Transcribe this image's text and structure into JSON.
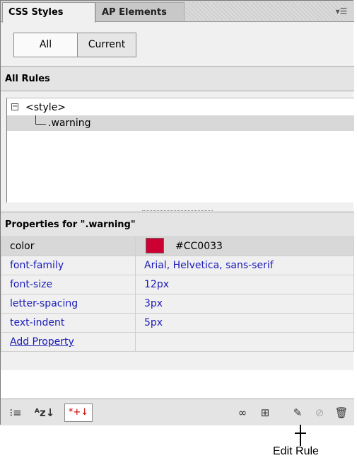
{
  "tabs": [
    {
      "label": "CSS Styles",
      "active": true
    },
    {
      "label": "AP Elements",
      "active": false
    }
  ],
  "panel_menu_icon": "panel-options-icon",
  "view_toggle": {
    "all_label": "All",
    "current_label": "Current",
    "selected": "All"
  },
  "all_rules": {
    "header": "All Rules",
    "tree": [
      {
        "label": "<style>",
        "expander": "⊟",
        "level": 0
      },
      {
        "label": ".warning",
        "level": 1,
        "selected": true
      }
    ]
  },
  "properties": {
    "header": "Properties for \".warning\"",
    "rows": [
      {
        "name": "color",
        "value": "#CC0033",
        "swatch": "#CC0033",
        "selected": true
      },
      {
        "name": "font-family",
        "value": "Arial, Helvetica, sans-serif"
      },
      {
        "name": "font-size",
        "value": "12px"
      },
      {
        "name": "letter-spacing",
        "value": "3px"
      },
      {
        "name": "text-indent",
        "value": "5px"
      }
    ],
    "add_property_label": "Add Property"
  },
  "toolbar": {
    "left_icons": [
      "category-view-icon",
      "list-view-icon",
      "set-properties-only-icon"
    ],
    "right_icons": [
      "attach-style-sheet-icon",
      "new-css-rule-icon",
      "edit-rule-icon",
      "disable-property-icon",
      "delete-rule-icon"
    ]
  },
  "callout": {
    "label": "Edit Rule"
  }
}
